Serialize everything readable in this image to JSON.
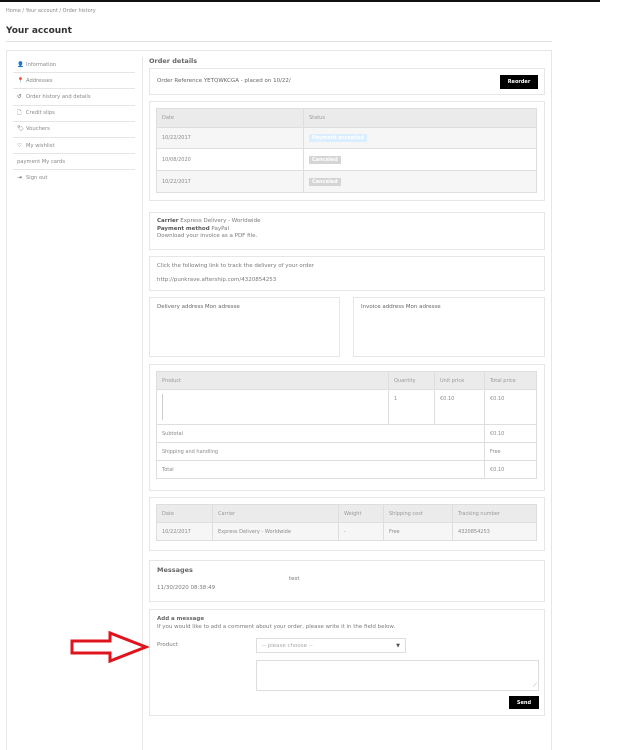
{
  "breadcrumb": "Home  /  Your account  /  Order history",
  "page_title": "Your account",
  "sidebar": [
    {
      "icon": "user-icon",
      "glyph": "👤",
      "label": "Information"
    },
    {
      "icon": "map-pin-icon",
      "glyph": "📍",
      "label": "Addresses"
    },
    {
      "icon": "history-icon",
      "glyph": "↺",
      "label": "Order history and details"
    },
    {
      "icon": "file-icon",
      "glyph": "🗋",
      "label": "Credit slips"
    },
    {
      "icon": "tags-icon",
      "glyph": "🏷",
      "label": "Vouchers"
    },
    {
      "icon": "heart-icon",
      "glyph": "♡",
      "label": "My wishlist"
    },
    {
      "icon": "",
      "glyph": "",
      "label": "payment My cards"
    },
    {
      "icon": "sign-out-icon",
      "glyph": "⇥",
      "label": "Sign out"
    }
  ],
  "order": {
    "heading": "Order details",
    "reference": "Order Reference YETQWKCGA - placed on 10/22/",
    "reorder": "Reorder",
    "status_headers": [
      "Date",
      "Status"
    ],
    "status_rows": [
      {
        "date": "10/22/2017",
        "status": "Payment accepted",
        "color": "#dbeeff"
      },
      {
        "date": "10/08/2020",
        "status": "Canceled",
        "color": "#d5d5d5"
      },
      {
        "date": "10/22/2017",
        "status": "Canceled",
        "color": "#d5d5d5"
      }
    ],
    "carrier_label": "Carrier",
    "carrier": "Express Delivery - Worldwide",
    "payment_label": "Payment method",
    "payment": "PayPal",
    "invoice_link": "Download your invoice as a PDF file.",
    "tracking_text": "Click the following link to track the delivery of your order",
    "tracking_url": "http://punkrave.aftership.com/4320854253",
    "delivery_address": "Delivery address Mon adresse",
    "invoice_address": "Invoice address Mon adresse",
    "product_headers": [
      "Product",
      "Quantity",
      "Unit price",
      "Total price"
    ],
    "product_row": {
      "qty": "1",
      "unit": "€0.10",
      "total": "€0.10"
    },
    "subtotal_label": "Subtotal",
    "subtotal": "€0.10",
    "shipping_label": "Shipping and handling",
    "shipping": "Free",
    "total_label": "Total",
    "total": "€0.10",
    "carrier_headers": [
      "Date",
      "Carrier",
      "Weight",
      "Shipping cost",
      "Tracking number"
    ],
    "carrier_row": [
      "10/22/2017",
      "Express Delivery - Worldwide",
      "-",
      "Free",
      "4320854253"
    ]
  },
  "messages": {
    "heading": "Messages",
    "text": "test",
    "date": "11/30/2020 08:38:49"
  },
  "add_message": {
    "heading": "Add a message",
    "hint": "If you would like to add a comment about your order, please write it in the field below.",
    "product_label": "Product",
    "select_value": "-- please choose --",
    "send": "Send"
  },
  "colors": {
    "arrow": "#e0141c"
  }
}
